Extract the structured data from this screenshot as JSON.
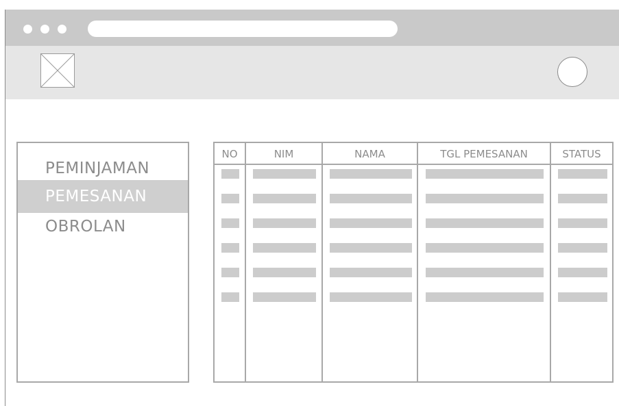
{
  "browser": {
    "window_dots": 3
  },
  "sidebar": {
    "items": [
      {
        "label": "PEMINJAMAN",
        "active": false
      },
      {
        "label": "PEMESANAN",
        "active": true
      },
      {
        "label": "OBROLAN",
        "active": false
      }
    ]
  },
  "table": {
    "columns": [
      "NO",
      "NIM",
      "NAMA",
      "TGL PEMESANAN",
      "STATUS"
    ],
    "placeholder_rows": 6
  },
  "colors": {
    "chrome": "#c9c9c9",
    "header": "#e6e6e6",
    "border": "#a8a8a8",
    "active_item": "#cfcfcf",
    "text": "#8c8c8c"
  }
}
